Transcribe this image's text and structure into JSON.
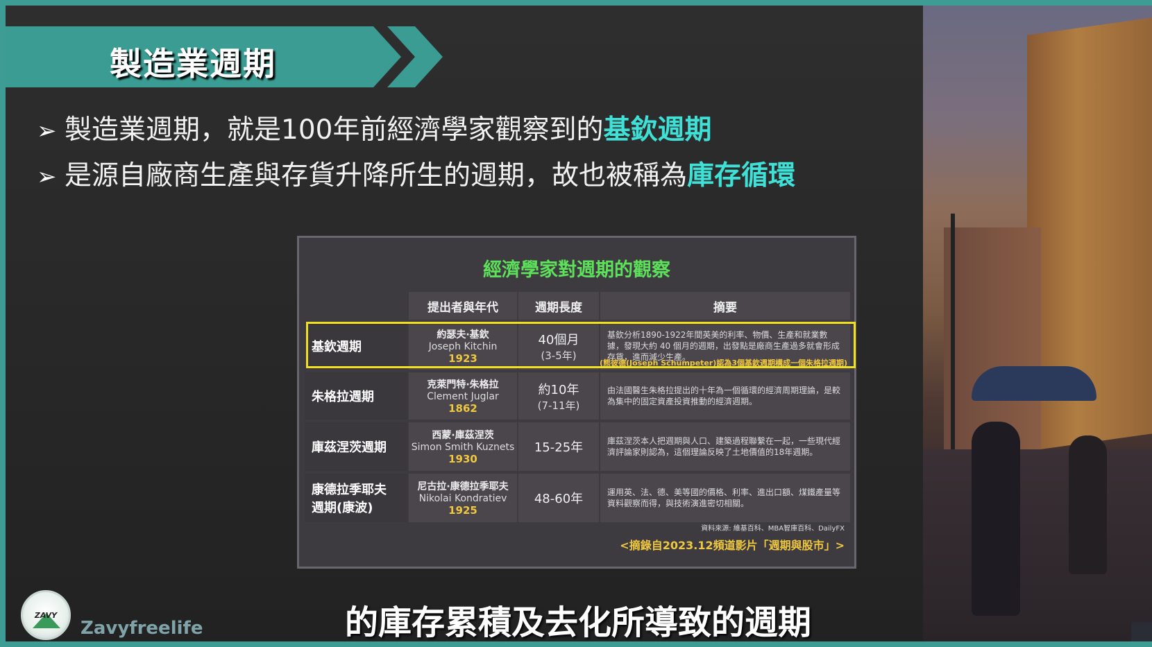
{
  "slide": {
    "title": "製造業週期",
    "bullets": [
      {
        "arrow": "➢",
        "text": "製造業週期，就是100年前經濟學家觀察到的",
        "highlight": "基欽週期"
      },
      {
        "arrow": "➢",
        "text": "是源自廠商生產與存貨升降所生的週期，故也被稱為",
        "highlight": "庫存循環"
      }
    ]
  },
  "table": {
    "title": "經濟學家對週期的觀察",
    "headers": [
      "提出者與年代",
      "週期長度",
      "摘要"
    ],
    "rows": [
      {
        "name": "基欽週期",
        "who_zh": "約瑟夫·基欽",
        "who_en": "Joseph Kitchin",
        "year": "1923",
        "length": "40個月",
        "length_sub": "(3-5年)",
        "summary": "基欽分析1890-1922年間英美的利率、物價、生產和就業數據，發現大約 40 個月的週期，出發點是廠商生產過多就會形成存貨，進而減少生產。"
      },
      {
        "name": "朱格拉週期",
        "who_zh": "克萊門特·朱格拉",
        "who_en": "Clement Juglar",
        "year": "1862",
        "length": "約10年",
        "length_sub": "(7-11年)",
        "summary": "由法國醫生朱格拉提出的十年為一個循環的經濟周期理論，是較為集中的固定資產投資推動的經濟週期。"
      },
      {
        "name": "庫茲涅茨週期",
        "who_zh": "西蒙·庫茲涅茨",
        "who_en": "Simon Smith Kuznets",
        "year": "1930",
        "length": "15-25年",
        "length_sub": "",
        "summary": "庫茲涅茨本人把週期與人口、建築過程聯繫在一起，一些現代經濟評論家則認為，這個理論反映了土地價值的18年週期。"
      },
      {
        "name": "康德拉季耶夫週期(康波)",
        "name_line1": "康德拉季耶夫",
        "name_line2": "週期(康波)",
        "who_zh": "尼古拉·康德拉季耶夫",
        "who_en": "Nikolai Kondratiev",
        "year": "1925",
        "length": "48-60年",
        "length_sub": "",
        "summary": "運用英、法、德、美等國的價格、利率、進出口額、煤鐵產量等資料觀察而得，與技術演進密切相關。"
      }
    ],
    "note": "(熊彼德(Joseph Schumpeter)認為3個基欽週期構成一個朱格拉週期)",
    "source": "資料來源: 維基百科、MBA智庫百科、DailyFX",
    "citation": "<摘錄自2023.12頻道影片「週期與股市」>"
  },
  "channel": {
    "logo_text": "ZAVY",
    "name": "Zavyfreelife"
  },
  "caption": "的庫存累積及去化所導致的週期",
  "colors": {
    "accent_teal": "#3b9c93",
    "highlight_cyan": "#3fe0d6",
    "table_title_green": "#5de05a",
    "year_gold": "#f0c840",
    "highlight_box_yellow": "#f0e020"
  }
}
